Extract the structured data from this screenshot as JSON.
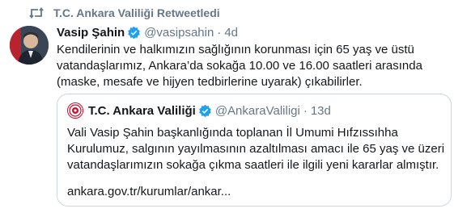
{
  "retweet": {
    "icon": "retweet-icon",
    "text": "T.C. Ankara Valiliği Retweetledi"
  },
  "tweet": {
    "avatar_icon": "user-avatar-photo",
    "name": "Vasip Şahin",
    "handle": "@vasipsahin",
    "separator": "·",
    "time": "4d",
    "text": "Kendilerinin ve halkımızın sağlığının korunması için 65 yaş ve üstü vatandaşlarımız, Ankara’da sokağa 10.00 ve 16.00 saatleri arasında (maske, mesafe ve hijyen tedbirlerine uyarak) çıkabilirler."
  },
  "quote": {
    "avatar_icon": "seal-logo",
    "name": "T.C. Ankara Valiliği",
    "handle": "@AnkaraValiligi",
    "separator": "·",
    "time": "13d",
    "text": "Vali Vasip Şahin başkanlığında toplanan İl Umumi Hıfzıssıhha Kurulumuz, salgının yayılmasının azaltılması amacı ile 65 yaş ve üzeri vatandaşlarımızın sokağa çıkma saatleri ile ilgili yeni kararlar almıştır.",
    "link": "ankara.gov.tr/kurumlar/ankar..."
  },
  "colors": {
    "verified": "#1da1f2",
    "muted": "#657786",
    "border": "#ccd6dd",
    "seal": "#c8102e"
  }
}
